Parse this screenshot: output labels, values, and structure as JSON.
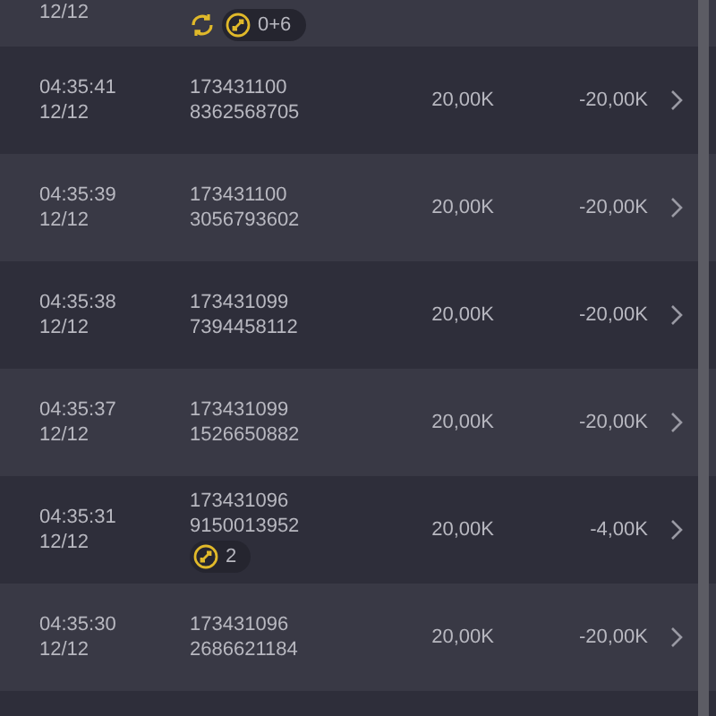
{
  "rows": [
    {
      "date": "12/12",
      "badges": [
        {
          "kind": "refresh"
        },
        {
          "kind": "count",
          "text": "0+6"
        }
      ]
    },
    {
      "time": "04:35:41",
      "date": "12/12",
      "id": "173431100",
      "ref": "8362568705",
      "amount": "20,00K",
      "net": "-20,00K"
    },
    {
      "time": "04:35:39",
      "date": "12/12",
      "id": "173431100",
      "ref": "3056793602",
      "amount": "20,00K",
      "net": "-20,00K"
    },
    {
      "time": "04:35:38",
      "date": "12/12",
      "id": "173431099",
      "ref": "7394458112",
      "amount": "20,00K",
      "net": "-20,00K"
    },
    {
      "time": "04:35:37",
      "date": "12/12",
      "id": "173431099",
      "ref": "1526650882",
      "amount": "20,00K",
      "net": "-20,00K"
    },
    {
      "time": "04:35:31",
      "date": "12/12",
      "id": "173431096",
      "ref": "9150013952",
      "amount": "20,00K",
      "net": "-4,00K",
      "badges": [
        {
          "kind": "count",
          "text": "2"
        }
      ]
    },
    {
      "time": "04:35:30",
      "date": "12/12",
      "id": "173431096",
      "ref": "2686621184",
      "amount": "20,00K",
      "net": "-20,00K"
    }
  ]
}
